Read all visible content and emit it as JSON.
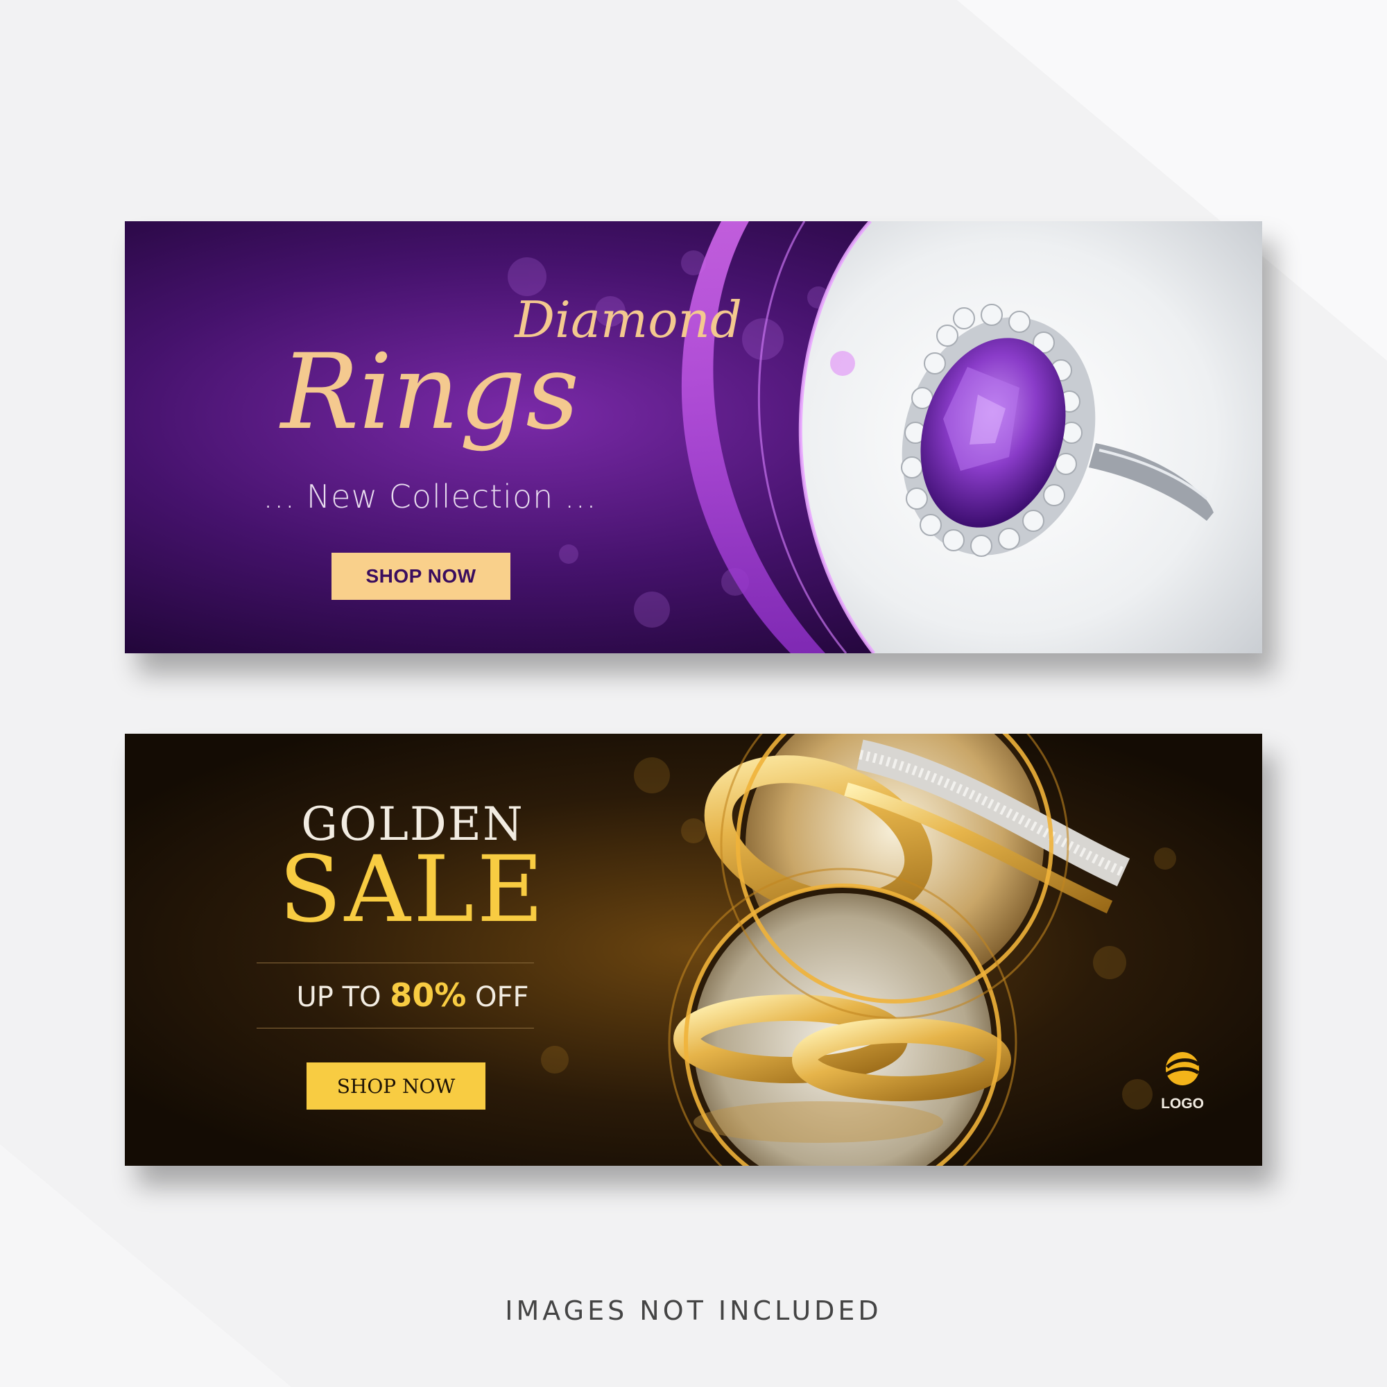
{
  "banner_purple": {
    "title_small": "Diamond",
    "title_large": "Rings",
    "subtitle": "... New Collection ...",
    "button_label": "SHOP NOW",
    "accent_color": "#f9d08b",
    "background_color": "#3a0d5e"
  },
  "banner_gold": {
    "title_top": "GOLDEN",
    "title_main": "SALE",
    "offer_prefix": "UP TO",
    "offer_percent": "80%",
    "offer_suffix": "OFF",
    "button_label": "SHOP NOW",
    "logo_label": "LOGO",
    "accent_color": "#f8cc42",
    "background_color": "#1c1206"
  },
  "footer": {
    "note": "IMAGES NOT INCLUDED"
  }
}
